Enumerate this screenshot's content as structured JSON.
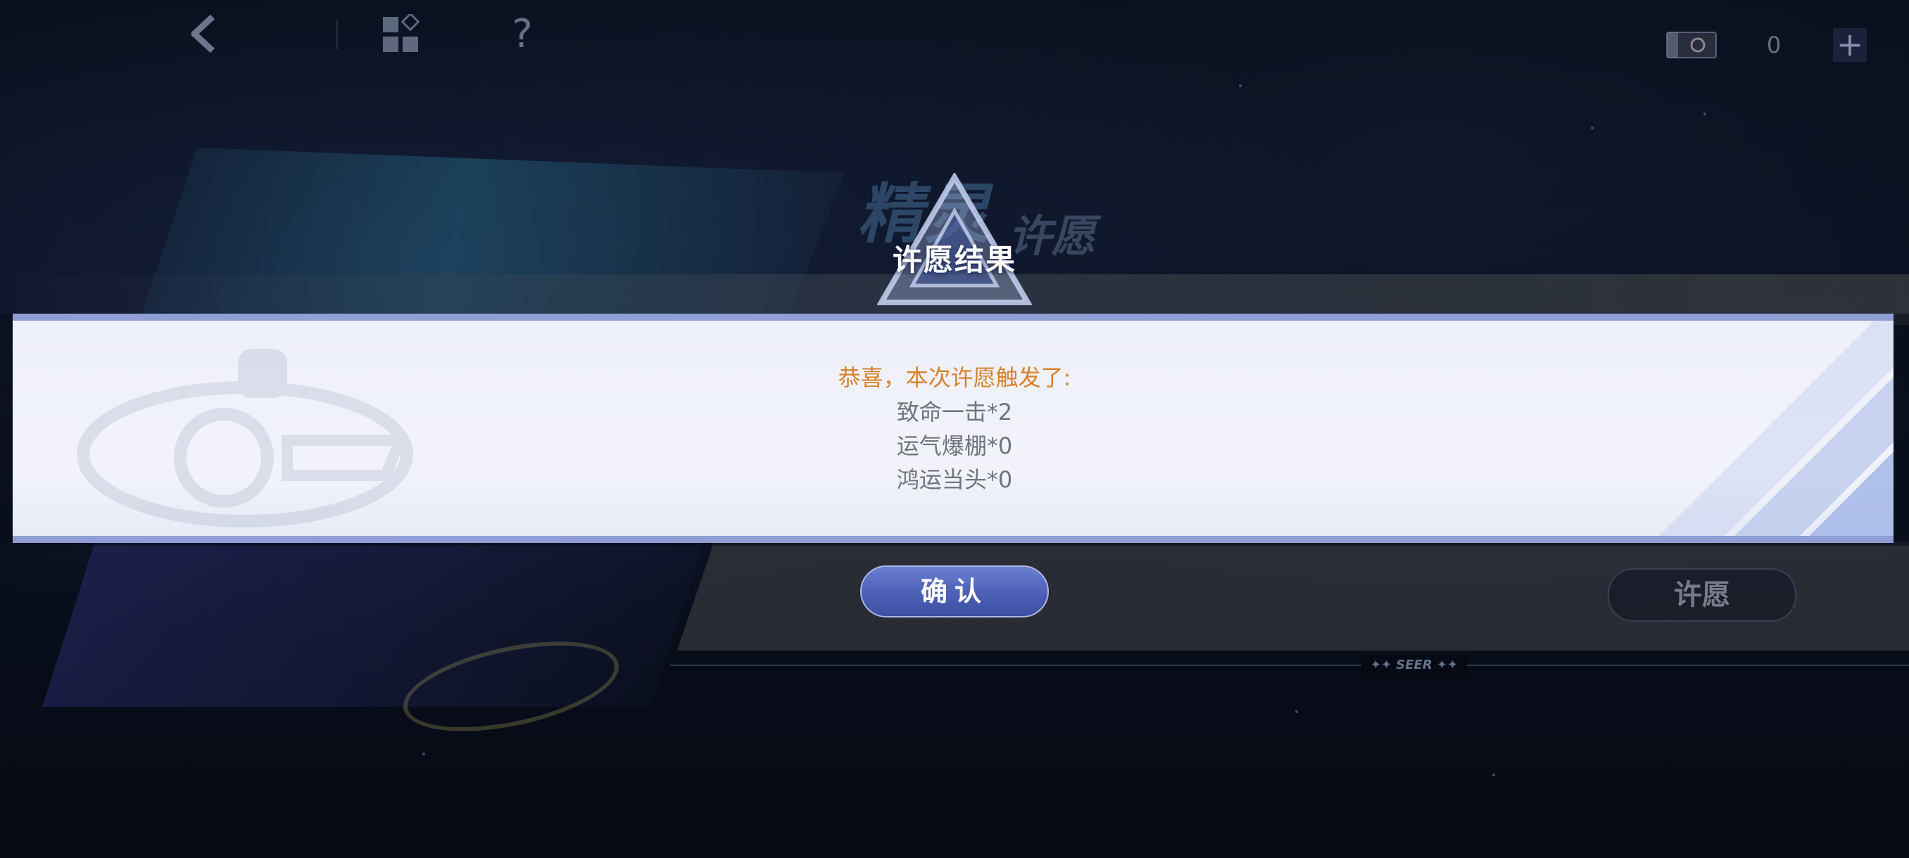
{
  "top_bar": {
    "help_glyph": "?",
    "currency_count": "0",
    "add_glyph": "+"
  },
  "background": {
    "logo_text": "精灵",
    "logo_sub": "许愿",
    "seer_mark": "✦✦ SEER ✦✦",
    "wish_button_label": "许愿"
  },
  "modal": {
    "title": "许愿结果",
    "heading": "恭喜，本次许愿触发了:",
    "results": [
      "致命一击*2",
      "运气爆棚*0",
      "鸿运当头*0"
    ],
    "confirm_label": "确认"
  },
  "colors": {
    "accent": "#8f9fd6",
    "heading": "#d8822a",
    "result_text": "#707380",
    "button": "#4b5fb6"
  }
}
